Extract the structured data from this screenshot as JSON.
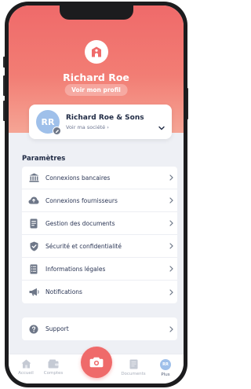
{
  "profile": {
    "name": "Richard Roe",
    "view_profile_label": "Voir mon profil"
  },
  "company": {
    "initials": "RR",
    "name": "Richard Roe & Sons",
    "link_label": "Voir ma société ›"
  },
  "settings": {
    "title": "Paramètres",
    "items": [
      {
        "label": "Connexions bancaires",
        "icon": "bank-icon"
      },
      {
        "label": "Connexions fournisseurs",
        "icon": "cloud-icon"
      },
      {
        "label": "Gestion des documents",
        "icon": "document-icon"
      },
      {
        "label": "Sécurité et confidentialité",
        "icon": "shield-check-icon"
      },
      {
        "label": "Informations légales",
        "icon": "legal-list-icon"
      },
      {
        "label": "Notifications",
        "icon": "megaphone-icon"
      }
    ]
  },
  "support": {
    "label": "Support",
    "icon": "help-icon"
  },
  "tabbar": {
    "items": [
      {
        "label": "Accueil",
        "icon": "home-icon"
      },
      {
        "label": "Comptes",
        "icon": "accounts-icon"
      },
      {
        "label": "",
        "icon": "camera-icon"
      },
      {
        "label": "Documents",
        "icon": "documents-icon"
      },
      {
        "label": "Plus",
        "icon": "avatar-icon",
        "initials": "RR"
      }
    ]
  },
  "colors": {
    "accent": "#ef6a6a",
    "avatar": "#9fc0ea",
    "icon": "#6e7788",
    "text": "#1f2a44"
  }
}
